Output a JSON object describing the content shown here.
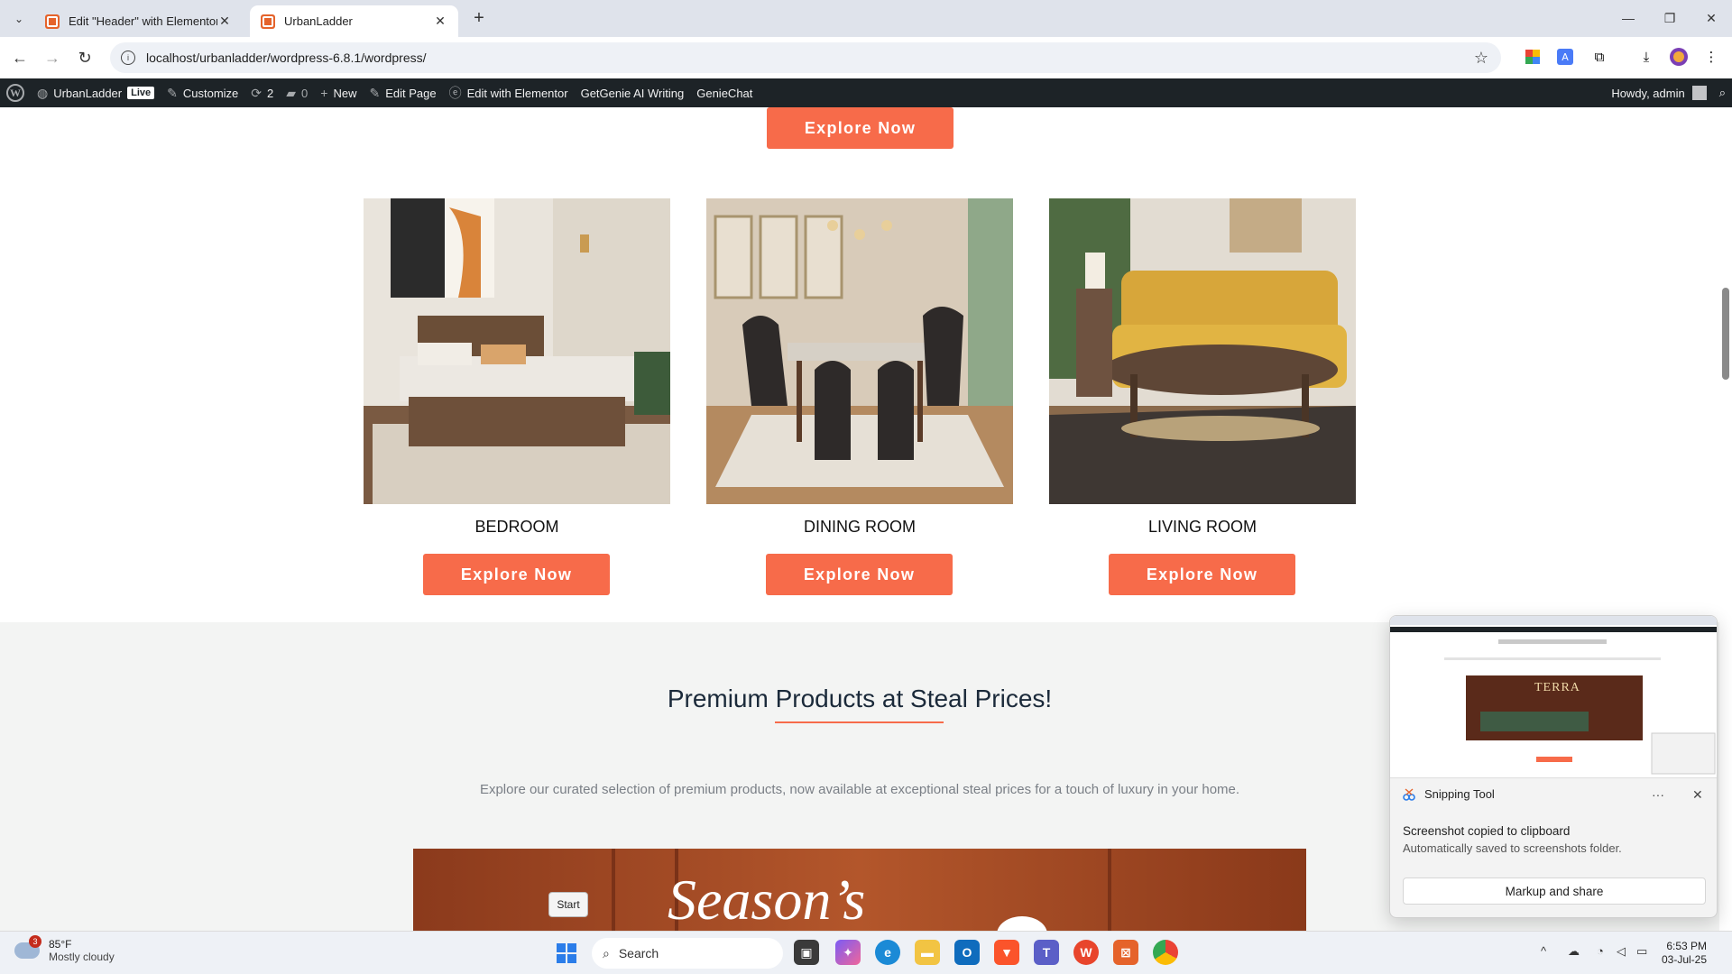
{
  "browser": {
    "tabs": [
      {
        "title": "Edit \"Header\" with Elementor",
        "active": false
      },
      {
        "title": "UrbanLadder",
        "active": true
      }
    ],
    "url": "localhost/urbanladder/wordpress-6.8.1/wordpress/"
  },
  "wp_admin_bar": {
    "site_name": "UrbanLadder",
    "live_label": "Live",
    "customize": "Customize",
    "updates_count": "2",
    "comments_count": "0",
    "new_label": "New",
    "edit_page": "Edit Page",
    "edit_elementor": "Edit with Elementor",
    "getgenie": "GetGenie AI Writing",
    "geniechat": "GenieChat",
    "howdy": "Howdy, admin"
  },
  "page": {
    "top_button": "Explore Now",
    "categories": [
      {
        "label": "BEDROOM",
        "button": "Explore Now"
      },
      {
        "label": "DINING ROOM",
        "button": "Explore Now"
      },
      {
        "label": "LIVING ROOM",
        "button": "Explore Now"
      }
    ],
    "section_title": "Premium Products at Steal Prices!",
    "section_desc": "Explore our curated selection of premium products, now available at exceptional steal prices for a touch of luxury in your home.",
    "banner_text": "Season’s",
    "start_tooltip": "Start"
  },
  "snipping_tool": {
    "app_name": "Snipping Tool",
    "message": "Screenshot copied to clipboard",
    "sub_message": "Automatically saved to screenshots folder.",
    "action": "Markup and share",
    "thumb_brand": "TERRA"
  },
  "taskbar": {
    "weather_temp": "85°F",
    "weather_desc": "Mostly cloudy",
    "weather_badge": "3",
    "search_placeholder": "Search",
    "time": "6:53 PM",
    "date": "03-Jul-25"
  },
  "colors": {
    "accent": "#f76b4a",
    "admin_bar": "#1d2327",
    "section_bg": "#f3f4f3"
  }
}
